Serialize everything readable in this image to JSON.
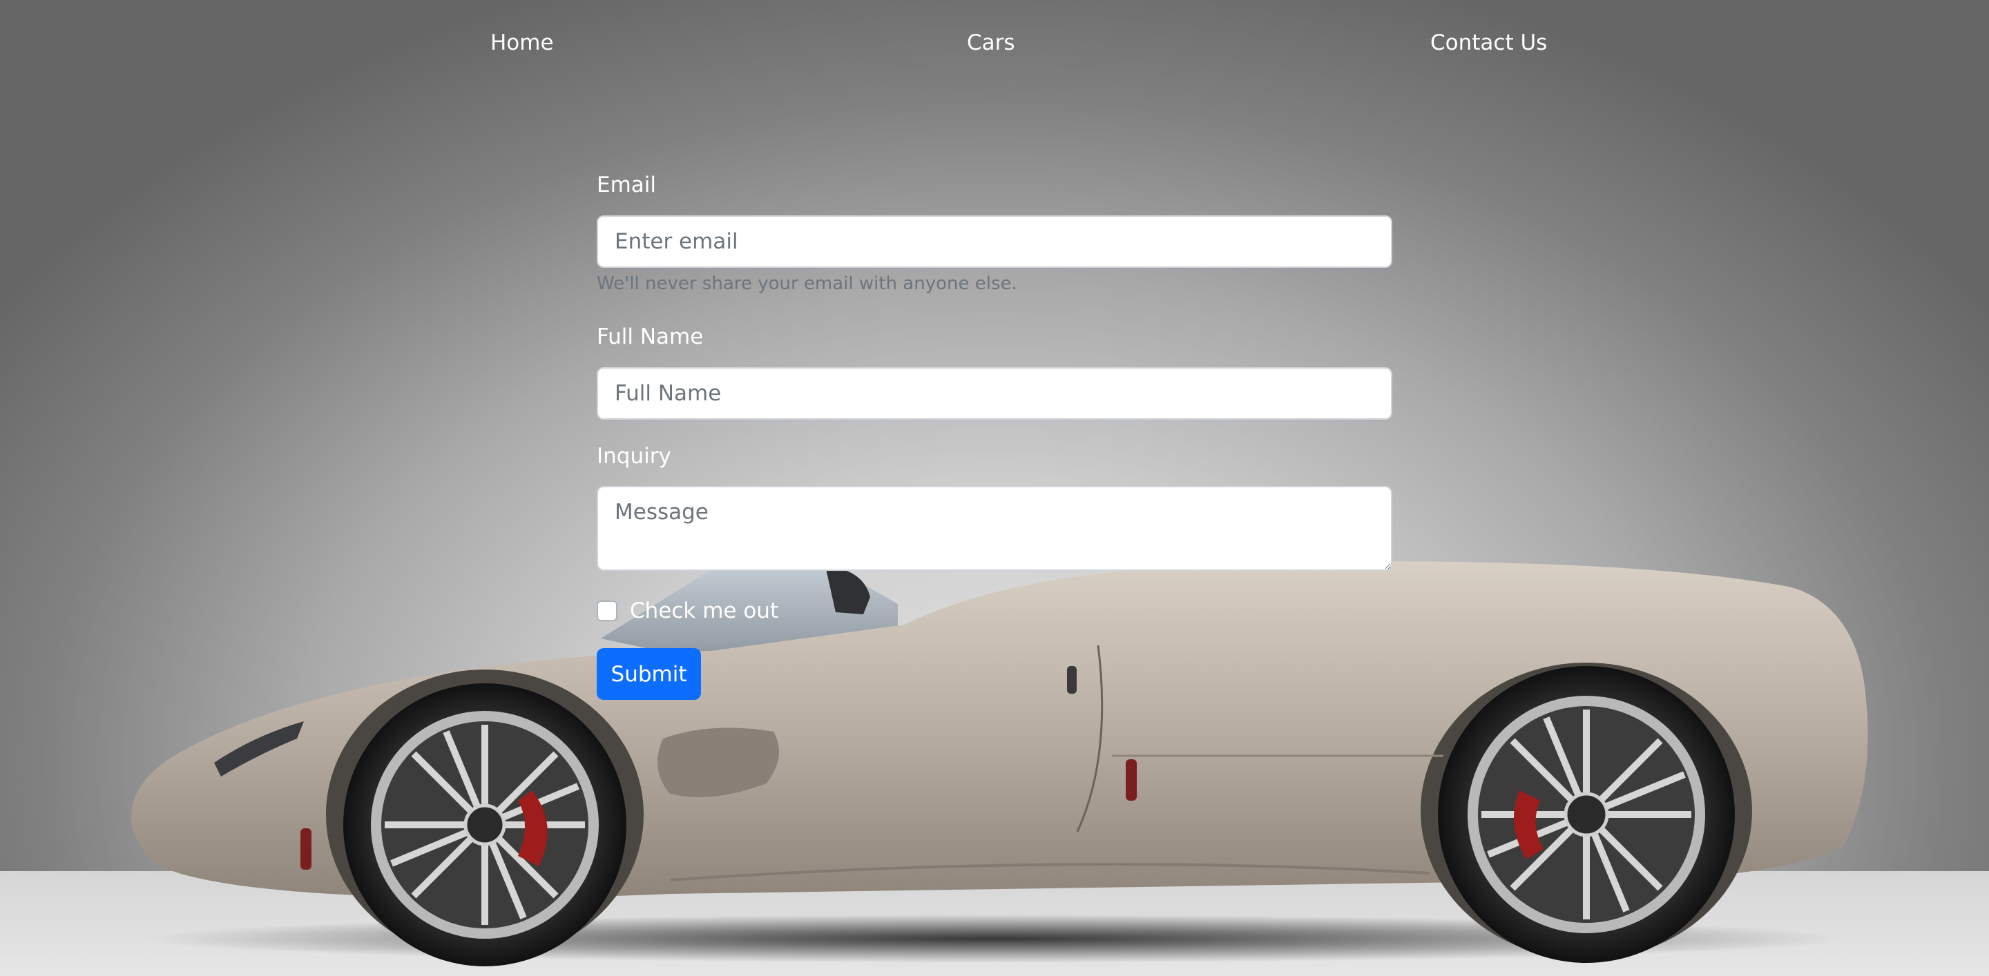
{
  "nav": {
    "home": "Home",
    "cars": "Cars",
    "contact": "Contact Us"
  },
  "form": {
    "email_label": "Email",
    "email_placeholder": "Enter email",
    "email_help": "We'll never share your email with anyone else.",
    "name_label": "Full Name",
    "name_placeholder": "Full Name",
    "inquiry_label": "Inquiry",
    "inquiry_placeholder": "Message",
    "check_label": "Check me out",
    "checked": false,
    "submit_label": "Submit"
  },
  "hero_image": {
    "subject": "champagne-colored roadster supercar, side profile",
    "body_color": "#bcb1a6"
  },
  "colors": {
    "primary_button": "#0d6efd",
    "nav_text": "#ffffff",
    "help_text": "#6c757d"
  }
}
